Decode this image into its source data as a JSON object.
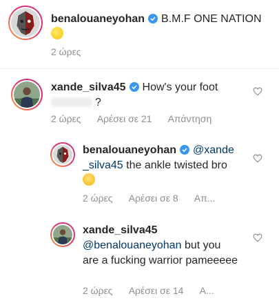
{
  "caption": {
    "username": "benalouaneyohan",
    "text": "B.M.F ONE NATION",
    "time": "2 ώρες"
  },
  "comments": [
    {
      "username": "xande_silva45",
      "text": "How's your foot",
      "text_tail": "?",
      "time": "2 ώρες",
      "likes": "Αρέσει σε 21",
      "reply": "Απάντηση"
    },
    {
      "username": "benalouaneyohan",
      "mention": "@xande _silva45",
      "text": "the ankle twisted bro",
      "time": "2 ώρες",
      "likes": "Αρέσει σε 8",
      "reply": "Απ..."
    },
    {
      "username": "xande_silva45",
      "mention": "@benalouaneyohan",
      "text": "but you are a fucking warrior pameeeee",
      "time": "2 ώρες",
      "likes": "Αρέσει σε 14",
      "reply": "Α..."
    }
  ],
  "colors": {
    "verified": "#3897f0",
    "mention": "#00376b",
    "meta": "#8e8e8e"
  }
}
